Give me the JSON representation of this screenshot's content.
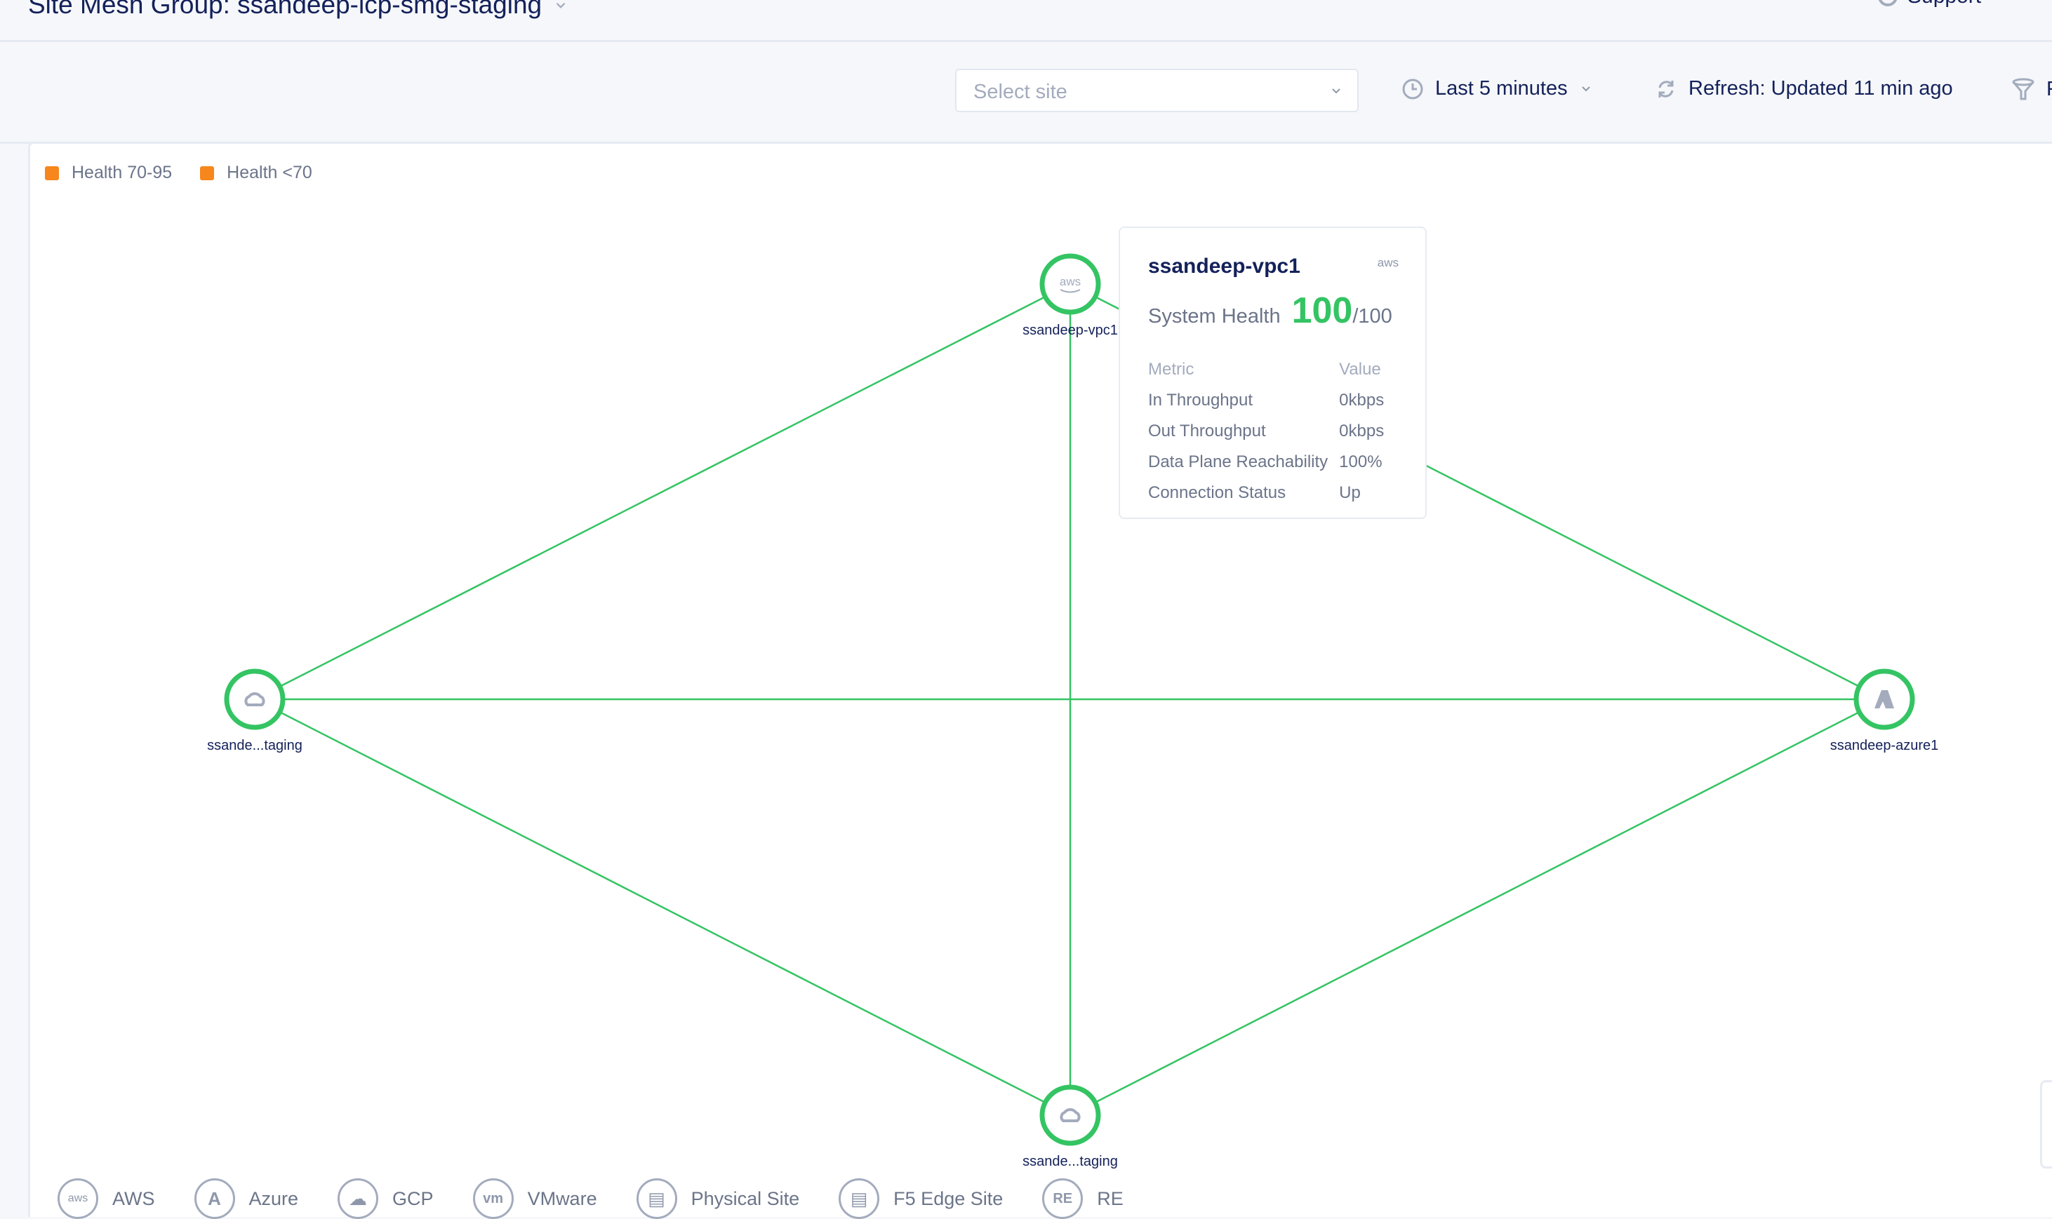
{
  "header": {
    "title": "Site Mesh Group: ssandeep-lcp-smg-staging",
    "support_label": "Support"
  },
  "toolbar": {
    "site_select_placeholder": "Select site",
    "time_range": "Last 5 minutes",
    "refresh_label": "Refresh: Updated 11 min ago",
    "filter_label": "F"
  },
  "legend": [
    {
      "label": "Health 70-95",
      "color": "#f7871c"
    },
    {
      "label": "Health <70",
      "color": "#f7871c"
    }
  ],
  "colors": {
    "healthy": "#34c463",
    "link": "#34c463",
    "icon": "#a3abbd"
  },
  "nodes": [
    {
      "id": "top",
      "label": "ssandeep-vpc1",
      "provider": "aws-icon"
    },
    {
      "id": "left",
      "label": "ssande...taging",
      "provider": "gcp-cloud-icon"
    },
    {
      "id": "right",
      "label": "ssandeep-azure1",
      "provider": "azure-icon"
    },
    {
      "id": "bottom",
      "label": "ssande...taging",
      "provider": "gcp-cloud-icon"
    }
  ],
  "links": [
    [
      "top",
      "left"
    ],
    [
      "top",
      "right"
    ],
    [
      "top",
      "bottom"
    ],
    [
      "left",
      "right"
    ],
    [
      "left",
      "bottom"
    ],
    [
      "right",
      "bottom"
    ]
  ],
  "tooltip": {
    "site_name": "ssandeep-vpc1",
    "provider_label": "aws",
    "health_label": "System Health",
    "health_value": "100",
    "health_max": "/100",
    "header_metric": "Metric",
    "header_value": "Value",
    "rows": [
      {
        "metric": "In Throughput",
        "value": "0kbps"
      },
      {
        "metric": "Out Throughput",
        "value": "0kbps"
      },
      {
        "metric": "Data Plane Reachability",
        "value": "100%"
      },
      {
        "metric": "Connection Status",
        "value": "Up"
      }
    ]
  },
  "provider_legend": [
    {
      "label": "AWS",
      "icon_text": "aws"
    },
    {
      "label": "Azure",
      "icon_text": "A"
    },
    {
      "label": "GCP",
      "icon_text": "☁"
    },
    {
      "label": "VMware",
      "icon_text": "vm"
    },
    {
      "label": "Physical Site",
      "icon_text": "▤"
    },
    {
      "label": "F5 Edge Site",
      "icon_text": "▤"
    },
    {
      "label": "RE",
      "icon_text": "RE"
    }
  ]
}
